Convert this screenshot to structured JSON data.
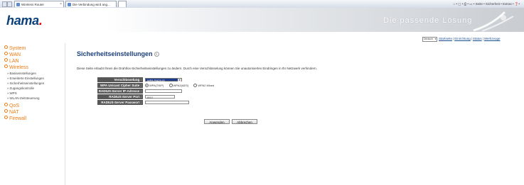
{
  "browser": {
    "tabs": [
      {
        "label": "Wireless Router"
      },
      {
        "label": "Die Verbindung wird ang..."
      }
    ],
    "tools_text": "⌂ • ▢ • ⎙ • ▭ • Seite • Sicherheit • Extras • ❓•"
  },
  "header": {
    "logo_text": "hama",
    "logo_dot": ".",
    "slogan": "Die passende Lösung"
  },
  "top": {
    "language_value": "Deutsch",
    "links": [
      "Startseite",
      "Einrichtung",
      "Status",
      "Werkzeuge"
    ]
  },
  "nav": {
    "main": [
      "System",
      "WAN",
      "LAN",
      "Wireless",
      "QoS",
      "NAT",
      "Firewall"
    ],
    "wireless_sub": [
      "Basiseinstellungen",
      "Erweiterte Einstellungen",
      "Sicherheitseinstellungen",
      "Zugangskontrolle",
      "WPS",
      "WLAN-Zeitsteuerung"
    ]
  },
  "page": {
    "title": "Sicherheitseinstellungen",
    "help_symbol": "?",
    "description": "Diese Seite erlaubt Ihnen die Drahtlos-Sicherheitseinstellungen zu ändern. Durch eine Verschlüsselung können Sie unautorisiertes Eindringen in Ihr Netzwerk verhindern."
  },
  "form": {
    "encryption_label": "Verschlüsselung :",
    "encryption_value": "WPA RADIUS",
    "cipher_label": "WPA Unicast Cipher Suite :",
    "cipher_options": [
      "WPA(TKIP)",
      "WPA2(AES)",
      "WPA2 Mixed"
    ],
    "radius_ip_label": "RADIUS-Server IP-Adresse :",
    "radius_ip_value": "",
    "radius_port_label": "RADIUS-Server Port :",
    "radius_port_value": "1812",
    "radius_pw_label": "RADIUS-Server Passwort :",
    "radius_pw_value": "",
    "apply_label": "Anwenden",
    "cancel_label": "Abbrechen"
  }
}
